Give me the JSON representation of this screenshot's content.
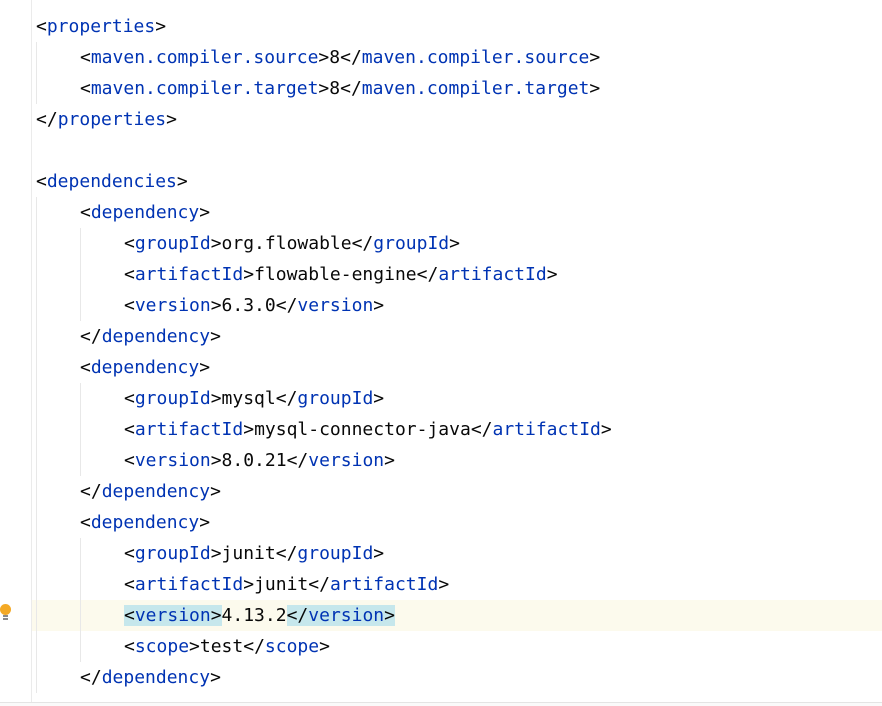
{
  "editor": {
    "lines": [
      {
        "indent": 0,
        "parts": [
          [
            "p",
            "<"
          ],
          [
            "t",
            "properties"
          ],
          [
            "p",
            ">"
          ]
        ]
      },
      {
        "indent": 1,
        "parts": [
          [
            "p",
            "<"
          ],
          [
            "t",
            "maven.compiler.source"
          ],
          [
            "p",
            ">"
          ],
          [
            "x",
            "8"
          ],
          [
            "p",
            "</"
          ],
          [
            "t",
            "maven.compiler.source"
          ],
          [
            "p",
            ">"
          ]
        ]
      },
      {
        "indent": 1,
        "parts": [
          [
            "p",
            "<"
          ],
          [
            "t",
            "maven.compiler.target"
          ],
          [
            "p",
            ">"
          ],
          [
            "x",
            "8"
          ],
          [
            "p",
            "</"
          ],
          [
            "t",
            "maven.compiler.target"
          ],
          [
            "p",
            ">"
          ]
        ]
      },
      {
        "indent": 0,
        "parts": [
          [
            "p",
            "</"
          ],
          [
            "t",
            "properties"
          ],
          [
            "p",
            ">"
          ]
        ]
      },
      {
        "indent": 0,
        "parts": []
      },
      {
        "indent": 0,
        "parts": [
          [
            "p",
            "<"
          ],
          [
            "t",
            "dependencies"
          ],
          [
            "p",
            ">"
          ]
        ]
      },
      {
        "indent": 1,
        "parts": [
          [
            "p",
            "<"
          ],
          [
            "t",
            "dependency"
          ],
          [
            "p",
            ">"
          ]
        ]
      },
      {
        "indent": 2,
        "parts": [
          [
            "p",
            "<"
          ],
          [
            "t",
            "groupId"
          ],
          [
            "p",
            ">"
          ],
          [
            "x",
            "org.flowable"
          ],
          [
            "p",
            "</"
          ],
          [
            "t",
            "groupId"
          ],
          [
            "p",
            ">"
          ]
        ]
      },
      {
        "indent": 2,
        "parts": [
          [
            "p",
            "<"
          ],
          [
            "t",
            "artifactId"
          ],
          [
            "p",
            ">"
          ],
          [
            "x",
            "flowable-engine"
          ],
          [
            "p",
            "</"
          ],
          [
            "t",
            "artifactId"
          ],
          [
            "p",
            ">"
          ]
        ]
      },
      {
        "indent": 2,
        "parts": [
          [
            "p",
            "<"
          ],
          [
            "t",
            "version"
          ],
          [
            "p",
            ">"
          ],
          [
            "x",
            "6.3.0"
          ],
          [
            "p",
            "</"
          ],
          [
            "t",
            "version"
          ],
          [
            "p",
            ">"
          ]
        ]
      },
      {
        "indent": 1,
        "parts": [
          [
            "p",
            "</"
          ],
          [
            "t",
            "dependency"
          ],
          [
            "p",
            ">"
          ]
        ]
      },
      {
        "indent": 1,
        "parts": [
          [
            "p",
            "<"
          ],
          [
            "t",
            "dependency"
          ],
          [
            "p",
            ">"
          ]
        ]
      },
      {
        "indent": 2,
        "parts": [
          [
            "p",
            "<"
          ],
          [
            "t",
            "groupId"
          ],
          [
            "p",
            ">"
          ],
          [
            "x",
            "mysql"
          ],
          [
            "p",
            "</"
          ],
          [
            "t",
            "groupId"
          ],
          [
            "p",
            ">"
          ]
        ]
      },
      {
        "indent": 2,
        "parts": [
          [
            "p",
            "<"
          ],
          [
            "t",
            "artifactId"
          ],
          [
            "p",
            ">"
          ],
          [
            "x",
            "mysql-connector-java"
          ],
          [
            "p",
            "</"
          ],
          [
            "t",
            "artifactId"
          ],
          [
            "p",
            ">"
          ]
        ]
      },
      {
        "indent": 2,
        "parts": [
          [
            "p",
            "<"
          ],
          [
            "t",
            "version"
          ],
          [
            "p",
            ">"
          ],
          [
            "x",
            "8.0.21"
          ],
          [
            "p",
            "</"
          ],
          [
            "t",
            "version"
          ],
          [
            "p",
            ">"
          ]
        ]
      },
      {
        "indent": 1,
        "parts": [
          [
            "p",
            "</"
          ],
          [
            "t",
            "dependency"
          ],
          [
            "p",
            ">"
          ]
        ]
      },
      {
        "indent": 1,
        "parts": [
          [
            "p",
            "<"
          ],
          [
            "t",
            "dependency"
          ],
          [
            "p",
            ">"
          ]
        ]
      },
      {
        "indent": 2,
        "parts": [
          [
            "p",
            "<"
          ],
          [
            "t",
            "groupId"
          ],
          [
            "p",
            ">"
          ],
          [
            "x",
            "junit"
          ],
          [
            "p",
            "</"
          ],
          [
            "t",
            "groupId"
          ],
          [
            "p",
            ">"
          ]
        ]
      },
      {
        "indent": 2,
        "parts": [
          [
            "p",
            "<"
          ],
          [
            "t",
            "artifactId"
          ],
          [
            "p",
            ">"
          ],
          [
            "x",
            "junit"
          ],
          [
            "p",
            "</"
          ],
          [
            "t",
            "artifactId"
          ],
          [
            "p",
            ">"
          ]
        ]
      },
      {
        "indent": 2,
        "caret": true,
        "parts": [
          [
            "hp",
            "<"
          ],
          [
            "ht",
            "version"
          ],
          [
            "hp",
            ">"
          ],
          [
            "x",
            "4.13.2"
          ],
          [
            "hp",
            "</"
          ],
          [
            "ht",
            "version"
          ],
          [
            "hp",
            ">"
          ]
        ]
      },
      {
        "indent": 2,
        "parts": [
          [
            "p",
            "<"
          ],
          [
            "t",
            "scope"
          ],
          [
            "p",
            ">"
          ],
          [
            "x",
            "test"
          ],
          [
            "p",
            "</"
          ],
          [
            "t",
            "scope"
          ],
          [
            "p",
            ">"
          ]
        ]
      },
      {
        "indent": 1,
        "parts": [
          [
            "p",
            "</"
          ],
          [
            "t",
            "dependency"
          ],
          [
            "p",
            ">"
          ]
        ]
      }
    ]
  },
  "icons": {
    "intention": "lightbulb-icon"
  },
  "colors": {
    "tag": "#0033b3",
    "text": "#080808",
    "caret_line": "#fcfaed",
    "brace_highlight": "#c6e7ec",
    "bulb": "#f4a925"
  }
}
